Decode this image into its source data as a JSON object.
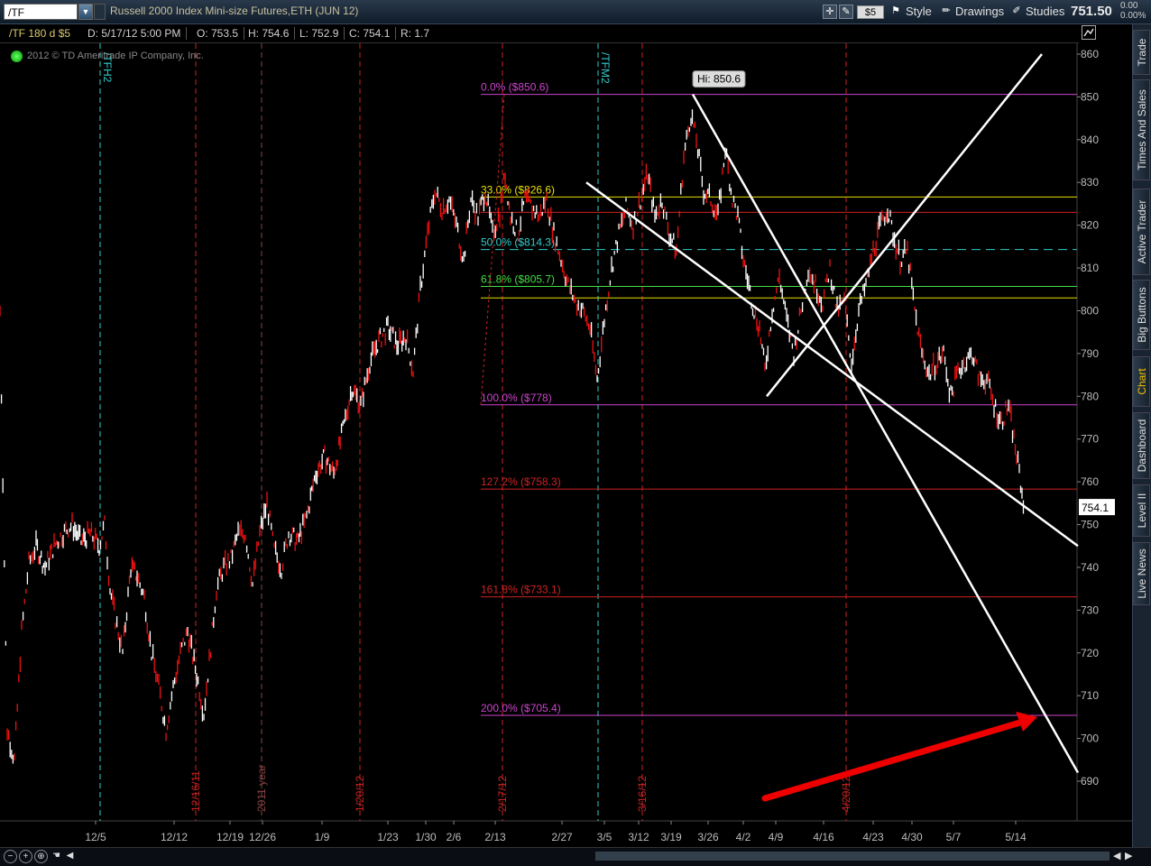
{
  "toolbar": {
    "symbol": "/TF",
    "title": "Russell 2000 Index Mini-size Futures,ETH (JUN 12)",
    "dollar_btn": "$5",
    "style": "Style",
    "drawings": "Drawings",
    "studies": "Studies",
    "last_price": "751.50",
    "pct_top": "0.00",
    "pct_bottom": "0.00%"
  },
  "info": {
    "symbol": "/TF 180 d $5",
    "date": "D: 5/17/12 5:00 PM",
    "open": "O: 753.5",
    "high": "H: 754.6",
    "low": "L: 752.9",
    "close": "C: 754.1",
    "range": "R: 1.7"
  },
  "copyright": "2012 © TD Ameritrade IP Company, Inc.",
  "side_tabs": [
    "Trade",
    "Times And Sales",
    "Active Trader",
    "Big Buttons",
    "Chart",
    "Dashboard",
    "Level II",
    "Live News"
  ],
  "chart_data": {
    "type": "candlestick",
    "title": "Russell 2000 Index Mini-size Futures,ETH (JUN 12)",
    "price_axis": [
      "860",
      "850",
      "840",
      "830",
      "820",
      "810",
      "800",
      "790",
      "780",
      "770",
      "760",
      "750",
      "740",
      "730",
      "720",
      "710",
      "700",
      "690"
    ],
    "ylim": [
      685,
      862
    ],
    "date_axis": [
      "12/5",
      "12/12",
      "12/19",
      "12/26",
      "1/9",
      "1/23",
      "1/30",
      "2/6",
      "2/13",
      "2/27",
      "3/5",
      "3/12",
      "3/19",
      "3/26",
      "4/2",
      "4/9",
      "4/16",
      "4/23",
      "4/30",
      "5/7",
      "5/14"
    ],
    "current_price_label": "754.1",
    "high_label": "Hi: 850.6",
    "fib_levels": [
      {
        "label": "0.0%  ($850.6)",
        "value": 850.6,
        "color": "#cc44cc"
      },
      {
        "label": "33.0%  ($826.6)",
        "value": 826.6,
        "color": "#e8e000"
      },
      {
        "label": "",
        "value": 823,
        "color": "#cc2222"
      },
      {
        "label": "50.0%  ($814.3)",
        "value": 814.3,
        "color": "#33cccc"
      },
      {
        "label": "61.8%  ($805.7)",
        "value": 805.7,
        "color": "#44dd44"
      },
      {
        "label": "",
        "value": 803,
        "color": "#e8e000"
      },
      {
        "label": "100.0%  ($778)",
        "value": 778,
        "color": "#cc44cc"
      },
      {
        "label": "127.2%  ($758.3)",
        "value": 758.3,
        "color": "#cc2222"
      },
      {
        "label": "161.8%  ($733.1)",
        "value": 733.1,
        "color": "#cc2222"
      },
      {
        "label": "200.0%  ($705.4)",
        "value": 705.4,
        "color": "#cc44cc"
      }
    ],
    "vertical_markers": [
      {
        "label": "/TFH2",
        "color": "#33cccc"
      },
      {
        "label": "12/16/11",
        "color": "#cc2222"
      },
      {
        "label": "2011 year",
        "color": "#884444"
      },
      {
        "label": "1/20/12",
        "color": "#cc2222"
      },
      {
        "label": "2/17/12",
        "color": "#cc2222"
      },
      {
        "label": "/TFM2",
        "color": "#33cccc"
      },
      {
        "label": "3/16/12",
        "color": "#cc2222"
      },
      {
        "label": "4/20/12",
        "color": "#cc2222"
      }
    ],
    "price_path": [
      [
        0,
        800
      ],
      [
        8,
        702
      ],
      [
        16,
        695
      ],
      [
        24,
        725
      ],
      [
        32,
        741
      ],
      [
        40,
        745
      ],
      [
        50,
        740
      ],
      [
        60,
        745
      ],
      [
        70,
        748
      ],
      [
        80,
        750
      ],
      [
        90,
        746
      ],
      [
        100,
        748
      ],
      [
        110,
        745
      ],
      [
        116,
        750
      ],
      [
        122,
        735
      ],
      [
        128,
        728
      ],
      [
        136,
        720
      ],
      [
        145,
        740
      ],
      [
        152,
        738
      ],
      [
        160,
        733
      ],
      [
        168,
        720
      ],
      [
        176,
        712
      ],
      [
        184,
        702
      ],
      [
        192,
        712
      ],
      [
        200,
        720
      ],
      [
        208,
        725
      ],
      [
        218,
        715
      ],
      [
        226,
        706
      ],
      [
        232,
        718
      ],
      [
        240,
        735
      ],
      [
        248,
        740
      ],
      [
        256,
        742
      ],
      [
        264,
        748
      ],
      [
        272,
        748
      ],
      [
        280,
        736
      ],
      [
        288,
        748
      ],
      [
        296,
        755
      ],
      [
        304,
        744
      ],
      [
        312,
        740
      ],
      [
        320,
        748
      ],
      [
        330,
        746
      ],
      [
        340,
        752
      ],
      [
        350,
        762
      ],
      [
        360,
        766
      ],
      [
        370,
        762
      ],
      [
        380,
        772
      ],
      [
        390,
        782
      ],
      [
        400,
        778
      ],
      [
        410,
        788
      ],
      [
        420,
        793
      ],
      [
        430,
        796
      ],
      [
        440,
        792
      ],
      [
        450,
        794
      ],
      [
        458,
        786
      ],
      [
        466,
        805
      ],
      [
        474,
        818
      ],
      [
        482,
        828
      ],
      [
        490,
        824
      ],
      [
        498,
        826
      ],
      [
        506,
        820
      ],
      [
        514,
        812
      ],
      [
        522,
        826
      ],
      [
        530,
        822
      ],
      [
        538,
        828
      ],
      [
        546,
        818
      ],
      [
        554,
        823
      ],
      [
        560,
        832
      ],
      [
        566,
        822
      ],
      [
        574,
        818
      ],
      [
        582,
        826
      ],
      [
        590,
        824
      ],
      [
        598,
        822
      ],
      [
        606,
        826
      ],
      [
        614,
        818
      ],
      [
        622,
        812
      ],
      [
        630,
        806
      ],
      [
        638,
        802
      ],
      [
        646,
        800
      ],
      [
        654,
        796
      ],
      [
        662,
        784
      ],
      [
        670,
        798
      ],
      [
        678,
        810
      ],
      [
        686,
        818
      ],
      [
        694,
        824
      ],
      [
        702,
        820
      ],
      [
        710,
        826
      ],
      [
        718,
        832
      ],
      [
        726,
        822
      ],
      [
        734,
        826
      ],
      [
        742,
        818
      ],
      [
        750,
        814
      ],
      [
        758,
        836
      ],
      [
        766,
        846
      ],
      [
        772,
        840
      ],
      [
        780,
        828
      ],
      [
        788,
        826
      ],
      [
        796,
        822
      ],
      [
        804,
        838
      ],
      [
        812,
        826
      ],
      [
        818,
        822
      ],
      [
        824,
        812
      ],
      [
        830,
        806
      ],
      [
        836,
        800
      ],
      [
        842,
        796
      ],
      [
        848,
        786
      ],
      [
        856,
        800
      ],
      [
        864,
        808
      ],
      [
        872,
        798
      ],
      [
        880,
        790
      ],
      [
        888,
        800
      ],
      [
        896,
        810
      ],
      [
        904,
        806
      ],
      [
        912,
        802
      ],
      [
        920,
        810
      ],
      [
        928,
        800
      ],
      [
        936,
        802
      ],
      [
        944,
        788
      ],
      [
        952,
        800
      ],
      [
        960,
        806
      ],
      [
        968,
        814
      ],
      [
        976,
        820
      ],
      [
        984,
        824
      ],
      [
        990,
        818
      ],
      [
        998,
        812
      ],
      [
        1006,
        814
      ],
      [
        1014,
        800
      ],
      [
        1022,
        790
      ],
      [
        1030,
        785
      ],
      [
        1038,
        788
      ],
      [
        1046,
        790
      ],
      [
        1054,
        780
      ],
      [
        1062,
        786
      ],
      [
        1070,
        788
      ],
      [
        1078,
        790
      ],
      [
        1086,
        784
      ],
      [
        1094,
        784
      ],
      [
        1102,
        778
      ],
      [
        1110,
        774
      ],
      [
        1118,
        778
      ],
      [
        1124,
        770
      ],
      [
        1130,
        762
      ],
      [
        1136,
        752
      ]
    ],
    "trendlines": [
      {
        "from": [
          650,
          830
        ],
        "to": [
          1195,
          745
        ]
      },
      {
        "from": [
          768,
          850.6
        ],
        "to": [
          1195,
          692
        ]
      },
      {
        "from": [
          850,
          780
        ],
        "to": [
          1155,
          860
        ]
      }
    ],
    "arrow": {
      "from": [
        848,
        686
      ],
      "to": [
        1150,
        705
      ]
    }
  }
}
